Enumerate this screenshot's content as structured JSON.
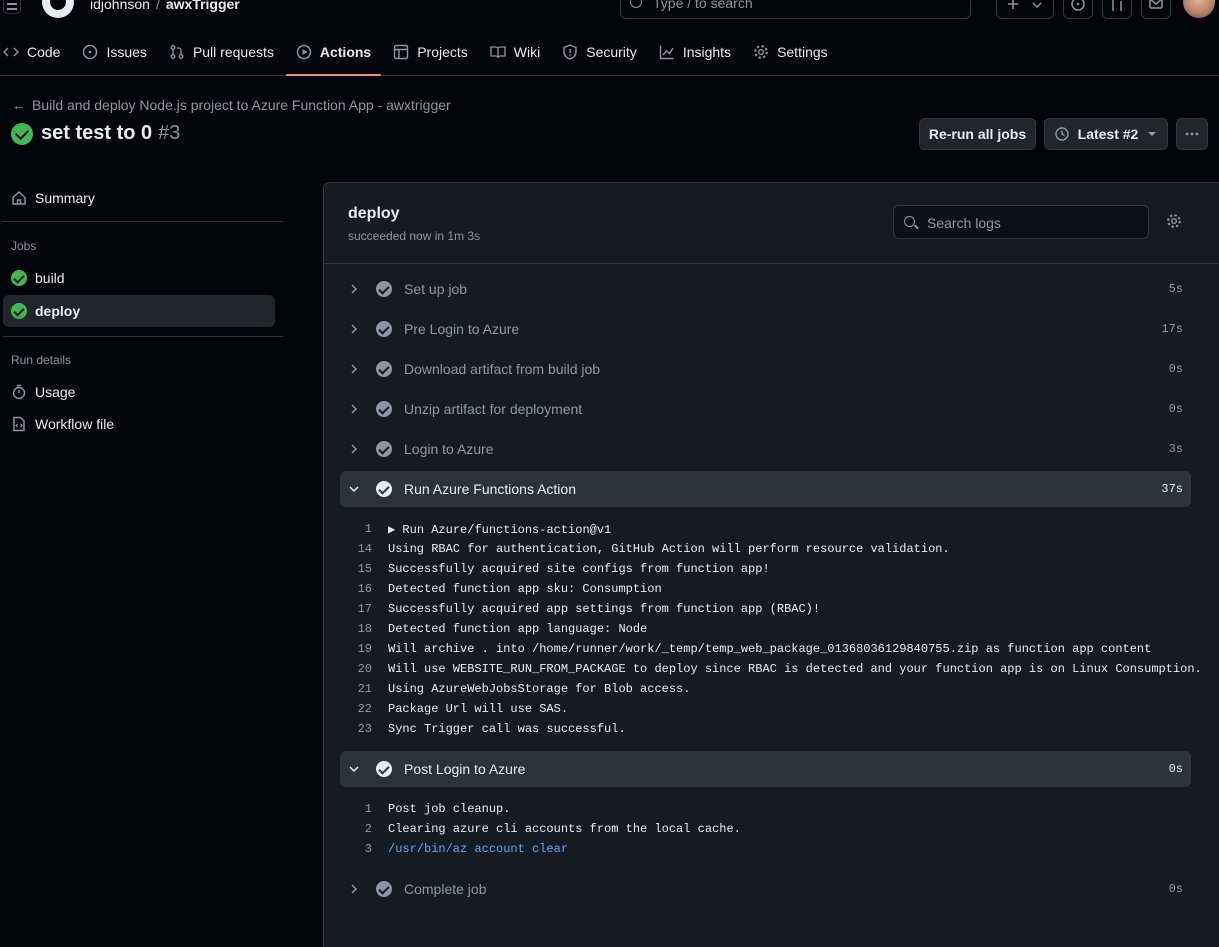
{
  "header": {
    "owner": "idjohnson",
    "separator": "/",
    "repo": "awxTrigger",
    "search_placeholder": "Type / to search",
    "nav": [
      {
        "label": "Code",
        "icon": "code-icon"
      },
      {
        "label": "Issues",
        "icon": "issue-icon"
      },
      {
        "label": "Pull requests",
        "icon": "pull-request-icon"
      },
      {
        "label": "Actions",
        "icon": "play-icon",
        "active": true
      },
      {
        "label": "Projects",
        "icon": "table-icon"
      },
      {
        "label": "Wiki",
        "icon": "book-icon"
      },
      {
        "label": "Security",
        "icon": "shield-icon"
      },
      {
        "label": "Insights",
        "icon": "graph-icon"
      },
      {
        "label": "Settings",
        "icon": "gear-icon"
      }
    ]
  },
  "run": {
    "workflow_back": "Build and deploy Node.js project to Azure Function App - awxtrigger",
    "title": "set test to 0",
    "number": "#3",
    "rerun_label": "Re-run all jobs",
    "latest_label": "Latest #2"
  },
  "sidebar": {
    "summary": "Summary",
    "jobs_heading": "Jobs",
    "jobs": [
      {
        "label": "build",
        "status": "success"
      },
      {
        "label": "deploy",
        "status": "success",
        "active": true
      }
    ],
    "run_details_heading": "Run details",
    "usage": "Usage",
    "workflow_file": "Workflow file"
  },
  "job": {
    "name": "deploy",
    "status_text": "succeeded now in 1m 3s",
    "search_placeholder": "Search logs",
    "steps": [
      {
        "name": "Set up job",
        "duration": "5s"
      },
      {
        "name": "Pre Login to Azure",
        "duration": "17s"
      },
      {
        "name": "Download artifact from build job",
        "duration": "0s"
      },
      {
        "name": "Unzip artifact for deployment",
        "duration": "0s"
      },
      {
        "name": "Login to Azure",
        "duration": "3s"
      },
      {
        "name": "Run Azure Functions Action",
        "duration": "37s",
        "expanded": true
      },
      {
        "name": "Post Login to Azure",
        "duration": "0s",
        "expanded": true
      },
      {
        "name": "Complete job",
        "duration": "0s"
      }
    ],
    "run_azure_logs": [
      {
        "n": "1",
        "text": "▶ Run Azure/functions-action@v1"
      },
      {
        "n": "14",
        "text": "Using RBAC for authentication, GitHub Action will perform resource validation."
      },
      {
        "n": "15",
        "text": "Successfully acquired site configs from function app!"
      },
      {
        "n": "16",
        "text": "Detected function app sku: Consumption"
      },
      {
        "n": "17",
        "text": "Successfully acquired app settings from function app (RBAC)!"
      },
      {
        "n": "18",
        "text": "Detected function app language: Node"
      },
      {
        "n": "19",
        "text": "Will archive . into /home/runner/work/_temp/temp_web_package_01368036129840755.zip as function app content"
      },
      {
        "n": "20",
        "text": "Will use WEBSITE_RUN_FROM_PACKAGE to deploy since RBAC is detected and your function app is on Linux Consumption."
      },
      {
        "n": "21",
        "text": "Using AzureWebJobsStorage for Blob access."
      },
      {
        "n": "22",
        "text": "Package Url will use SAS."
      },
      {
        "n": "23",
        "text": "Sync Trigger call was successful."
      }
    ],
    "post_login_logs": [
      {
        "n": "1",
        "text": "Post job cleanup."
      },
      {
        "n": "2",
        "text": "Clearing azure cli accounts from the local cache."
      },
      {
        "n": "3",
        "text": "/usr/bin/az account clear",
        "command": true
      }
    ]
  },
  "colors": {
    "success": "#3fb950",
    "active_tab_underline": "#fd8c73",
    "command_text": "#58a6ff"
  }
}
